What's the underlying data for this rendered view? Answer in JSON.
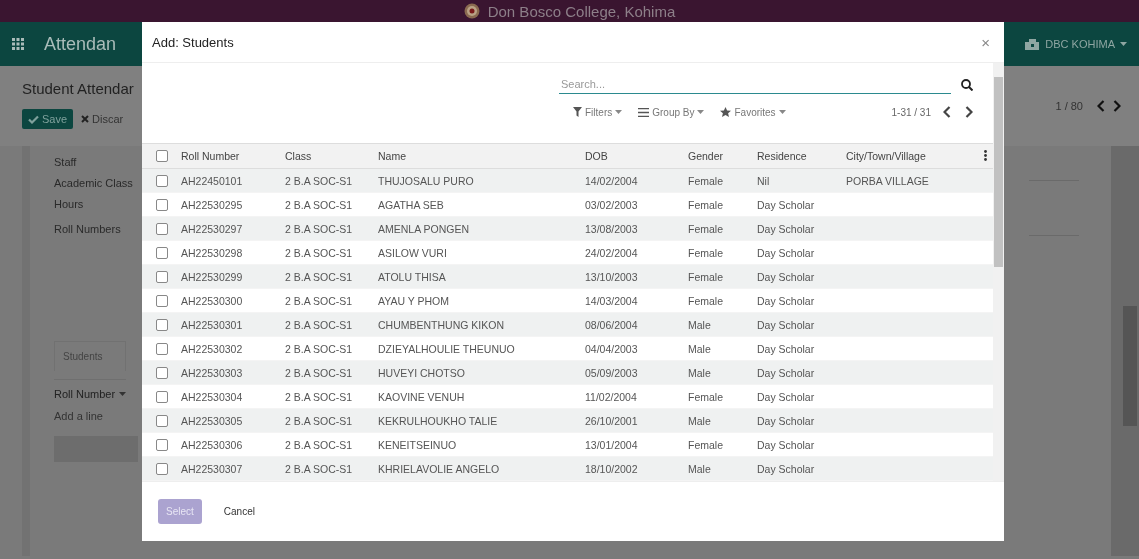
{
  "app_header": {
    "title": "Don Bosco College, Kohima"
  },
  "navbar": {
    "app_name": "Attendan",
    "company": "DBC KOHIMA"
  },
  "form": {
    "breadcrumb": "Student Attendar",
    "save_button": "Save",
    "discard_button": "Discar",
    "pager": "1 / 80",
    "fields": [
      {
        "label": "Staff"
      },
      {
        "label": "Academic Class"
      },
      {
        "label": "Hours"
      },
      {
        "label": "Roll Numbers"
      }
    ],
    "tab": "Students",
    "column": "Roll Number",
    "add_line": "Add a line"
  },
  "dialog": {
    "title": "Add: Students",
    "close": "×",
    "search": {
      "placeholder": "Search..."
    },
    "filters": [
      {
        "label": "Filters",
        "kind": "filter"
      },
      {
        "label": "Group By",
        "kind": "group"
      },
      {
        "label": "Favorites",
        "kind": "favorite"
      }
    ],
    "pager": "1-31 / 31",
    "select_all": {
      "checked": false
    },
    "columns": [
      "Roll Number",
      "Class",
      "Name",
      "DOB",
      "Gender",
      "Residence",
      "City/Town/Village"
    ],
    "rows": [
      {
        "checked": false,
        "cells": [
          "AH22450101",
          "2 B.A SOC-S1",
          "THUJOSALU PURO",
          "14/02/2004",
          "Female",
          "Nil",
          "PORBA VILLAGE"
        ]
      },
      {
        "checked": false,
        "cells": [
          "AH22530295",
          "2 B.A SOC-S1",
          "AGATHA SEB",
          "03/02/2003",
          "Female",
          "Day Scholar",
          ""
        ]
      },
      {
        "checked": false,
        "cells": [
          "AH22530297",
          "2 B.A SOC-S1",
          "AMENLA PONGEN",
          "13/08/2003",
          "Female",
          "Day Scholar",
          ""
        ]
      },
      {
        "checked": false,
        "cells": [
          "AH22530298",
          "2 B.A SOC-S1",
          "ASILOW VURI",
          "24/02/2004",
          "Female",
          "Day Scholar",
          ""
        ]
      },
      {
        "checked": false,
        "cells": [
          "AH22530299",
          "2 B.A SOC-S1",
          "ATOLU THISA",
          "13/10/2003",
          "Female",
          "Day Scholar",
          ""
        ]
      },
      {
        "checked": false,
        "cells": [
          "AH22530300",
          "2 B.A SOC-S1",
          "AYAU Y PHOM",
          "14/03/2004",
          "Female",
          "Day Scholar",
          ""
        ]
      },
      {
        "checked": false,
        "cells": [
          "AH22530301",
          "2 B.A SOC-S1",
          "CHUMBENTHUNG KIKON",
          "08/06/2004",
          "Male",
          "Day Scholar",
          ""
        ]
      },
      {
        "checked": false,
        "cells": [
          "AH22530302",
          "2 B.A SOC-S1",
          "DZIEYALHOULIE THEUNUO",
          "04/04/2003",
          "Male",
          "Day Scholar",
          ""
        ]
      },
      {
        "checked": false,
        "cells": [
          "AH22530303",
          "2 B.A SOC-S1",
          "HUVEYI CHOTSO",
          "05/09/2003",
          "Male",
          "Day Scholar",
          ""
        ]
      },
      {
        "checked": false,
        "cells": [
          "AH22530304",
          "2 B.A SOC-S1",
          "KAOVINE VENUH",
          "11/02/2004",
          "Female",
          "Day Scholar",
          ""
        ]
      },
      {
        "checked": false,
        "cells": [
          "AH22530305",
          "2 B.A SOC-S1",
          "KEKRULHOUKHO TALIE",
          "26/10/2001",
          "Male",
          "Day Scholar",
          ""
        ]
      },
      {
        "checked": false,
        "cells": [
          "AH22530306",
          "2 B.A SOC-S1",
          "KENEITSEINUO",
          "13/01/2004",
          "Female",
          "Day Scholar",
          ""
        ]
      },
      {
        "checked": false,
        "cells": [
          "AH22530307",
          "2 B.A SOC-S1",
          "KHRIELAVOLIE ANGELO",
          "18/10/2002",
          "Male",
          "Day Scholar",
          ""
        ]
      }
    ],
    "buttons": [
      {
        "label": "Select",
        "kind": "primary",
        "disabled": true
      },
      {
        "label": "Cancel",
        "kind": "secondary",
        "disabled": false
      }
    ]
  }
}
